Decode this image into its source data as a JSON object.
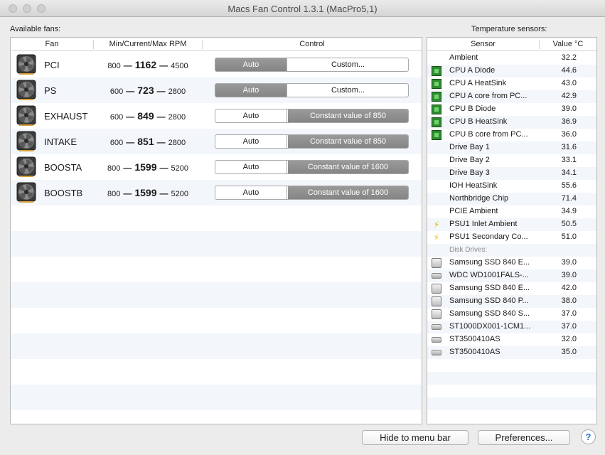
{
  "window": {
    "title": "Macs Fan Control 1.3.1 (MacPro5,1)"
  },
  "fans_section": {
    "label": "Available fans:",
    "headers": {
      "fan": "Fan",
      "rpm": "Min/Current/Max RPM",
      "control": "Control"
    },
    "fans": [
      {
        "name": "PCI",
        "min": "800",
        "current": "1162",
        "max": "4500",
        "auto": "Auto",
        "custom": "Custom...",
        "mode": "auto"
      },
      {
        "name": "PS",
        "min": "600",
        "current": "723",
        "max": "2800",
        "auto": "Auto",
        "custom": "Custom...",
        "mode": "auto"
      },
      {
        "name": "EXHAUST",
        "min": "600",
        "current": "849",
        "max": "2800",
        "auto": "Auto",
        "custom": "Constant value of 850",
        "mode": "custom"
      },
      {
        "name": "INTAKE",
        "min": "600",
        "current": "851",
        "max": "2800",
        "auto": "Auto",
        "custom": "Constant value of 850",
        "mode": "custom"
      },
      {
        "name": "BOOSTA",
        "min": "800",
        "current": "1599",
        "max": "5200",
        "auto": "Auto",
        "custom": "Constant value of 1600",
        "mode": "custom"
      },
      {
        "name": "BOOSTB",
        "min": "800",
        "current": "1599",
        "max": "5200",
        "auto": "Auto",
        "custom": "Constant value of 1600",
        "mode": "custom"
      }
    ]
  },
  "sensors_section": {
    "label": "Temperature sensors:",
    "headers": {
      "sensor": "Sensor",
      "value": "Value °C"
    },
    "rows": [
      {
        "type": "sensor",
        "icon": "none",
        "name": "Ambient",
        "value": "32.2"
      },
      {
        "type": "sensor",
        "icon": "chip-icon",
        "name": "CPU A Diode",
        "value": "44.6"
      },
      {
        "type": "sensor",
        "icon": "chip-icon",
        "name": "CPU A HeatSink",
        "value": "43.0"
      },
      {
        "type": "sensor",
        "icon": "chip-icon",
        "name": "CPU A core from PC...",
        "value": "42.9"
      },
      {
        "type": "sensor",
        "icon": "chip-icon",
        "name": "CPU B Diode",
        "value": "39.0"
      },
      {
        "type": "sensor",
        "icon": "chip-icon",
        "name": "CPU B HeatSink",
        "value": "36.9"
      },
      {
        "type": "sensor",
        "icon": "chip-icon",
        "name": "CPU B core from PC...",
        "value": "36.0"
      },
      {
        "type": "sensor",
        "icon": "none",
        "name": "Drive Bay 1",
        "value": "31.6"
      },
      {
        "type": "sensor",
        "icon": "none",
        "name": "Drive Bay 2",
        "value": "33.1"
      },
      {
        "type": "sensor",
        "icon": "none",
        "name": "Drive Bay 3",
        "value": "34.1"
      },
      {
        "type": "sensor",
        "icon": "none",
        "name": "IOH HeatSink",
        "value": "55.6"
      },
      {
        "type": "sensor",
        "icon": "none",
        "name": "Northbridge Chip",
        "value": "71.4"
      },
      {
        "type": "sensor",
        "icon": "none",
        "name": "PCIE Ambient",
        "value": "34.9"
      },
      {
        "type": "sensor",
        "icon": "bolt-icon",
        "name": "PSU1 Inlet Ambient",
        "value": "50.5"
      },
      {
        "type": "sensor",
        "icon": "bolt-icon",
        "name": "PSU1 Secondary Co...",
        "value": "51.0"
      },
      {
        "type": "group",
        "name": "Disk Drives:"
      },
      {
        "type": "sensor",
        "icon": "ssd-icon",
        "name": "Samsung SSD 840 E...",
        "value": "39.0"
      },
      {
        "type": "sensor",
        "icon": "hdd-icon",
        "name": "WDC WD1001FALS-...",
        "value": "39.0"
      },
      {
        "type": "sensor",
        "icon": "ssd-icon",
        "name": "Samsung SSD 840 E...",
        "value": "42.0"
      },
      {
        "type": "sensor",
        "icon": "ssd-icon",
        "name": "Samsung SSD 840 P...",
        "value": "38.0"
      },
      {
        "type": "sensor",
        "icon": "ssd-icon",
        "name": "Samsung SSD 840 S...",
        "value": "37.0"
      },
      {
        "type": "sensor",
        "icon": "hdd-icon",
        "name": "ST1000DX001-1CM1...",
        "value": "37.0"
      },
      {
        "type": "sensor",
        "icon": "hdd-icon",
        "name": "ST3500410AS",
        "value": "32.0"
      },
      {
        "type": "sensor",
        "icon": "hdd-icon",
        "name": "ST3500410AS",
        "value": "35.0"
      }
    ]
  },
  "buttons": {
    "hide": "Hide to menu bar",
    "preferences": "Preferences...",
    "help": "?"
  },
  "colors": {
    "segment_active": "#8f8f8f",
    "row_alt": "#f3f6fa",
    "chip": "#2f8a2f",
    "bolt": "#e8b600"
  }
}
